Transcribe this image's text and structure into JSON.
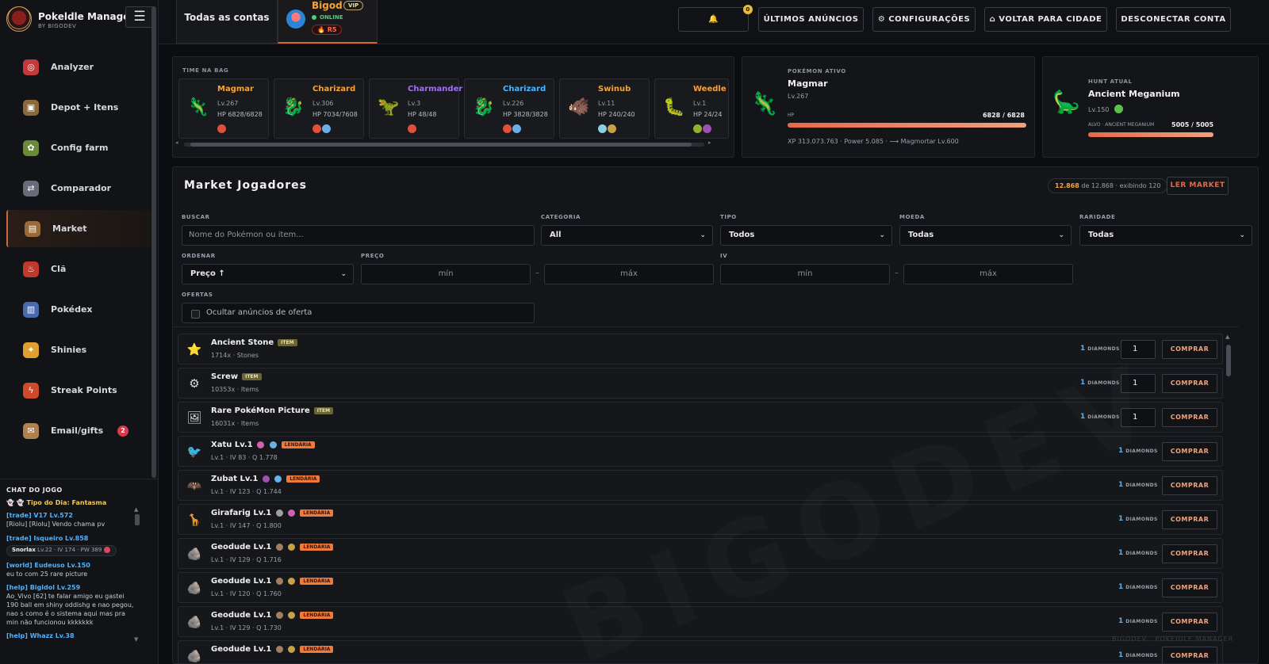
{
  "brand": {
    "name": "Pokeldle Manager",
    "sub": "BY BIGODEV"
  },
  "sidebar": {
    "items": [
      {
        "label": "Analyzer",
        "icon": "target-icon"
      },
      {
        "label": "Depot + Itens",
        "icon": "box-icon"
      },
      {
        "label": "Config farm",
        "icon": "farm-icon"
      },
      {
        "label": "Comparador",
        "icon": "compare-icon"
      },
      {
        "label": "Market",
        "icon": "chest-icon",
        "active": true
      },
      {
        "label": "Clã",
        "icon": "flame-icon"
      },
      {
        "label": "Pokédex",
        "icon": "book-icon"
      },
      {
        "label": "Shinies",
        "icon": "sparkle-icon"
      },
      {
        "label": "Streak Points",
        "icon": "bolt-icon"
      },
      {
        "label": "Email/gifts",
        "icon": "mail-icon",
        "badge": "2"
      }
    ]
  },
  "chat": {
    "title": "CHAT DO JOGO",
    "tip": "Tipo do Dia: Fantasma",
    "messages": [
      {
        "who": "[trade] V17 Lv.572",
        "text": "[Riolu] [Riolu] Vendo chama pv"
      },
      {
        "who": "[trade] Isqueiro Lv.858",
        "poke_name": "Snorlax",
        "poke_stats": "Lv.22 · IV 174 · PW 389"
      },
      {
        "who": "[world] Eudeuso Lv.150",
        "text": "eu to com 25 rare picture"
      },
      {
        "who": "[help] Bigldol Lv.259",
        "text": "Ao_Vivo [62] te falar amigo eu gastei 190 ball em shiny oddishg e nao pegou, nao s como é o sistema aqui mas pra min não funcionou kkkkkkk"
      },
      {
        "who": "[help] Whazz Lv.38",
        "text": ""
      }
    ]
  },
  "topbar": {
    "all_accounts": "Todas as contas",
    "account": {
      "name": "Bigod",
      "vip": "VIP",
      "status": "ONLINE",
      "coin": "🔥 R5"
    },
    "bell_count": "0",
    "buttons": {
      "announcements": "ÚLTIMOS ANÚNCIOS",
      "settings": "⚙ CONFIGURAÇÕES",
      "city": "⌂ VOLTAR PARA CIDADE",
      "disconnect": "DESCONECTAR CONTA"
    }
  },
  "team": {
    "label": "TIME NA BAG",
    "cards": [
      {
        "name": "Magmar",
        "level": "Lv.267",
        "hp": "HP 6828/6828",
        "color": "#f5a23b",
        "sprite": "🦎",
        "types": [
          "#e0503a"
        ]
      },
      {
        "name": "Charizard",
        "level": "Lv.306",
        "hp": "HP 7034/7608",
        "color": "#f5a23b",
        "sprite": "🐉",
        "types": [
          "#e0503a",
          "#6ab0e8"
        ]
      },
      {
        "name": "Charmander",
        "level": "Lv.3",
        "hp": "HP 48/48",
        "color": "#a070f0",
        "sprite": "🦖",
        "types": [
          "#e0503a"
        ]
      },
      {
        "name": "Charizard",
        "level": "Lv.226",
        "hp": "HP 3828/3828",
        "color": "#4cb3ff",
        "sprite": "🐉",
        "types": [
          "#e0503a",
          "#6ab0e8"
        ]
      },
      {
        "name": "Swinub",
        "level": "Lv.11",
        "hp": "HP 240/240",
        "color": "#f5a23b",
        "sprite": "🐗",
        "types": [
          "#8ad0e0",
          "#c8a048"
        ]
      },
      {
        "name": "Weedle",
        "level": "Lv.1",
        "hp": "HP 24/24",
        "color": "#f5a23b",
        "sprite": "🐛",
        "types": [
          "#90b030",
          "#a050b0"
        ]
      }
    ]
  },
  "active_pokemon": {
    "label": "POKÉMON ATIVO",
    "name": "Magmar",
    "level": "Lv.267",
    "hp_label": "HP",
    "hp_value": "6828 / 6828",
    "hp_fraction": 1.0,
    "footer": "XP 313.073.763 · Power 5.085 · ⟶ Magmortar Lv.600"
  },
  "hunt": {
    "label": "HUNT ATUAL",
    "name": "Ancient Meganium",
    "level": "Lv.150",
    "target_label": "ALVO · ANCIENT MEGANIUM",
    "target_value": "5005 / 5005",
    "fraction": 1.0
  },
  "market": {
    "title": "Market Jogadores",
    "count_strong": "12.868",
    "count_rest": "de 12.868 · exibindo 120",
    "read_button": "LER MARKET",
    "filters": {
      "search_label": "BUSCAR",
      "search_placeholder": "Nome do Pokémon ou item...",
      "category_label": "CATEGORIA",
      "category_value": "All",
      "type_label": "TIPO",
      "type_value": "Todos",
      "currency_label": "MOEDA",
      "currency_value": "Todas",
      "rarity_label": "RARIDADE",
      "rarity_value": "Todas",
      "order_label": "ORDENAR",
      "order_value": "Preço ↑",
      "price_label": "PREÇO",
      "min": "mín",
      "max": "máx",
      "iv_label": "IV",
      "offers_label": "OFERTAS",
      "offers_checkbox": "Ocultar anúncios de oferta"
    },
    "rows": [
      {
        "name": "Ancient Stone",
        "tag": "ITEM",
        "sub": "1714x · Stones",
        "price": "1",
        "currency": "DIAMONDS",
        "qty": "1",
        "icon": "⭐",
        "types": []
      },
      {
        "name": "Screw",
        "tag": "ITEM",
        "sub": "10353x · Items",
        "price": "1",
        "currency": "DIAMONDS",
        "qty": "1",
        "icon": "⚙",
        "types": []
      },
      {
        "name": "Rare PokéMon Picture",
        "tag": "ITEM",
        "sub": "16031x · Items",
        "price": "1",
        "currency": "DIAMONDS",
        "qty": "1",
        "icon": "🖼",
        "types": []
      },
      {
        "name": "Xatu Lv.1",
        "tag": "LENDÁRIA",
        "sub": "Lv.1 · IV 83 · Q 1.778",
        "price": "1",
        "currency": "DIAMONDS",
        "icon": "🐦",
        "types": [
          "#d060b0",
          "#6ab0e8"
        ]
      },
      {
        "name": "Zubat Lv.1",
        "tag": "LENDÁRIA",
        "sub": "Lv.1 · IV 123 · Q 1.744",
        "price": "1",
        "currency": "DIAMONDS",
        "icon": "🦇",
        "types": [
          "#a050b0",
          "#6ab0e8"
        ]
      },
      {
        "name": "Girafarig Lv.1",
        "tag": "LENDÁRIA",
        "sub": "Lv.1 · IV 147 · Q 1.800",
        "price": "1",
        "currency": "DIAMONDS",
        "icon": "🦒",
        "types": [
          "#a0a0a0",
          "#d060b0"
        ]
      },
      {
        "name": "Geodude Lv.1",
        "tag": "LENDÁRIA",
        "sub": "Lv.1 · IV 129 · Q 1.716",
        "price": "1",
        "currency": "DIAMONDS",
        "icon": "🪨",
        "types": [
          "#a08060",
          "#c8a048"
        ]
      },
      {
        "name": "Geodude Lv.1",
        "tag": "LENDÁRIA",
        "sub": "Lv.1 · IV 120 · Q 1.760",
        "price": "1",
        "currency": "DIAMONDS",
        "icon": "🪨",
        "types": [
          "#a08060",
          "#c8a048"
        ]
      },
      {
        "name": "Geodude Lv.1",
        "tag": "LENDÁRIA",
        "sub": "Lv.1 · IV 129 · Q 1.730",
        "price": "1",
        "currency": "DIAMONDS",
        "icon": "🪨",
        "types": [
          "#a08060",
          "#c8a048"
        ]
      },
      {
        "name": "Geodude Lv.1",
        "tag": "LENDÁRIA",
        "sub": "",
        "price": "1",
        "currency": "DIAMONDS",
        "icon": "🪨",
        "types": [
          "#a08060",
          "#c8a048"
        ]
      }
    ],
    "buy_label": "COMPRAR"
  },
  "watermark": "BIGODEV",
  "footer_mark": "BIGODEV · POKEIDLE MANAGER"
}
